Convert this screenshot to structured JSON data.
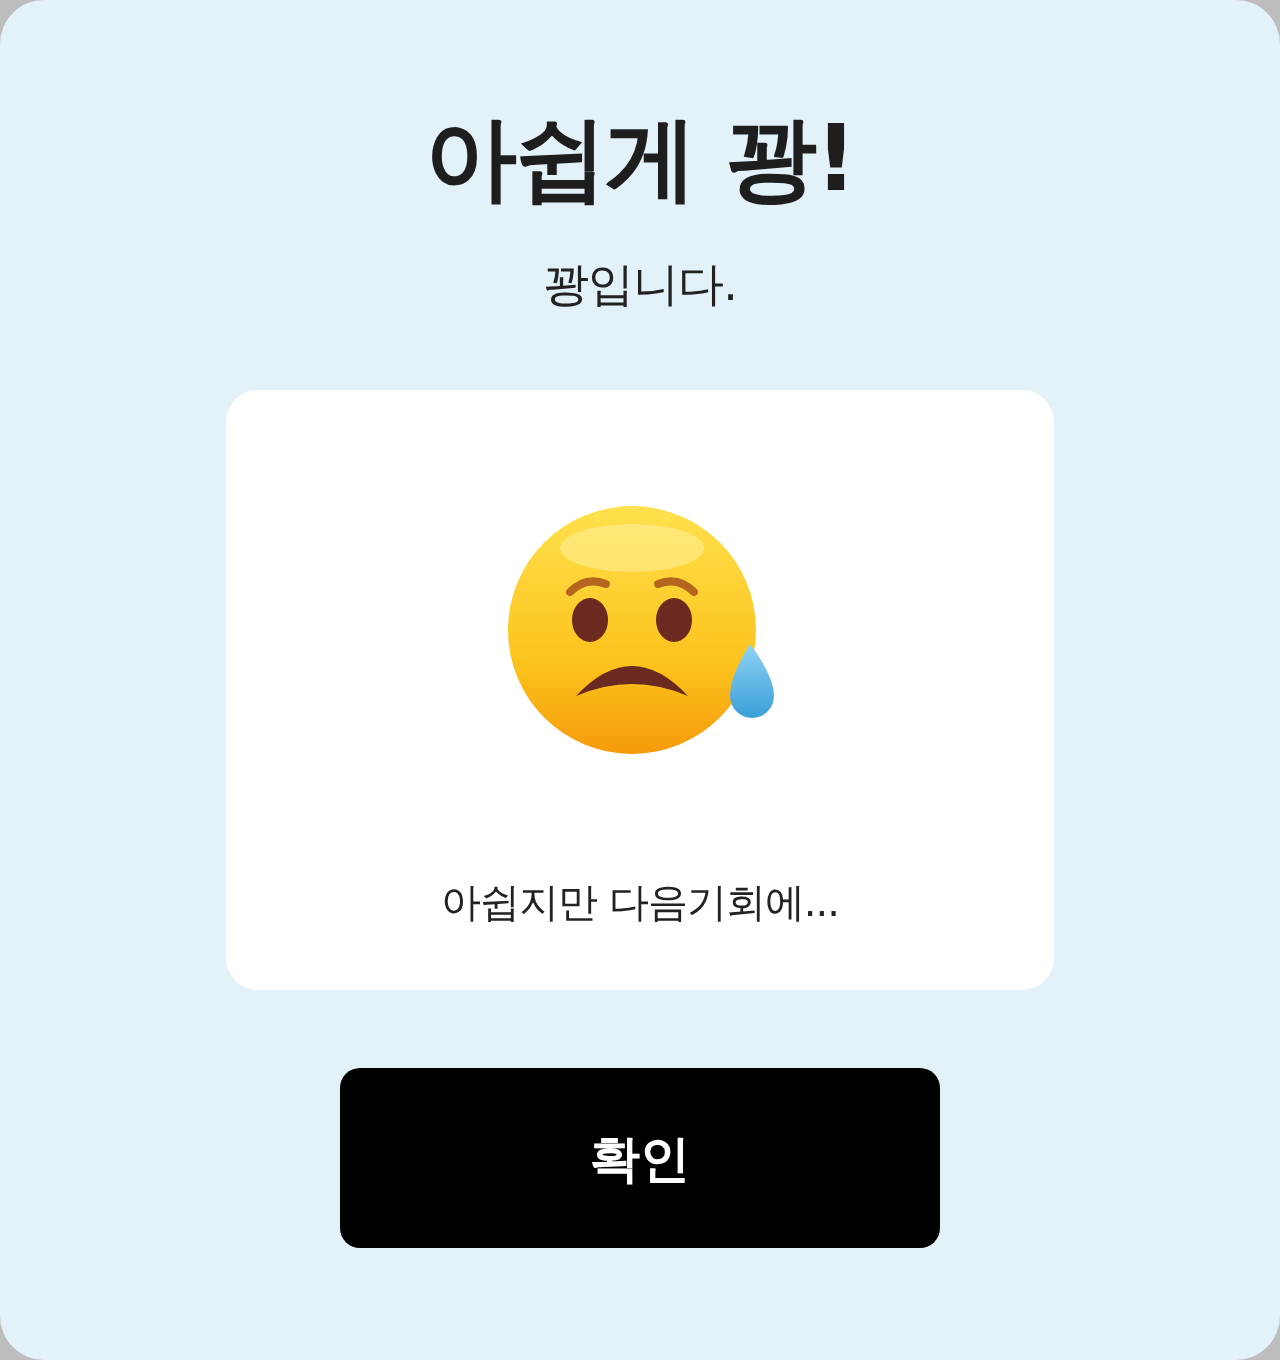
{
  "dialog": {
    "title": "아쉽게 꽝!",
    "subtitle": "꽝입니다.",
    "card": {
      "message": "아쉽지만 다음기회에..."
    },
    "button": {
      "label": "확인"
    }
  }
}
